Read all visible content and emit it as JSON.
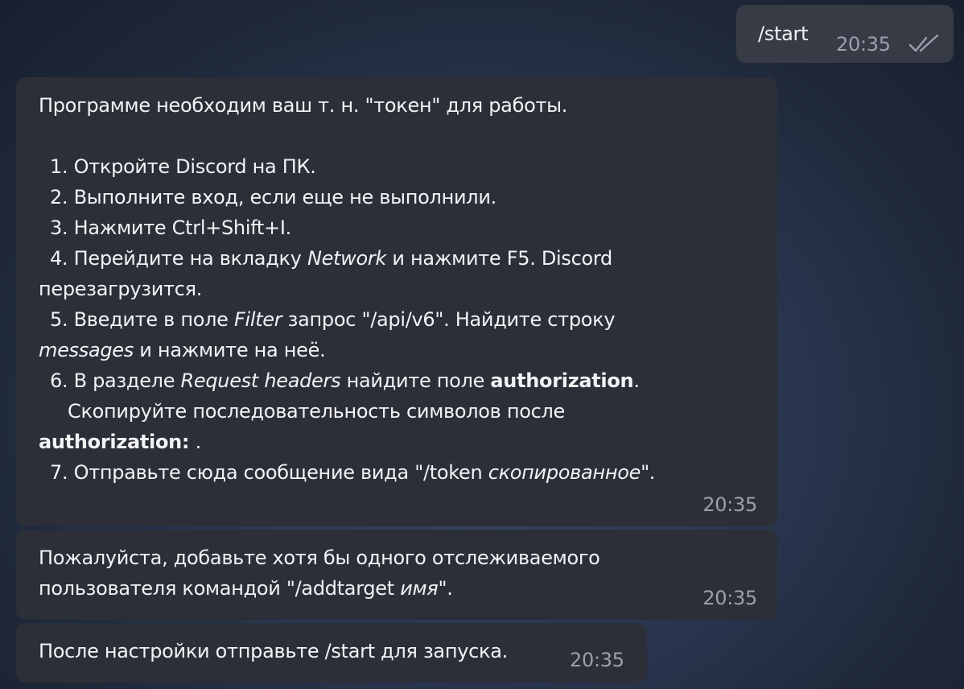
{
  "messages": {
    "outgoing": {
      "text": "/start",
      "time": "20:35",
      "status_icon": "double-check-icon"
    },
    "bot_1": {
      "intro": "Программе необходим ваш т. н. \"токен\" для работы.",
      "step1": "1. Откройте Discord на ПК.",
      "step2": "2. Выполните вход, если еще не выполнили.",
      "step3": "3. Нажмите Ctrl+Shift+I.",
      "step4_a": "4. Перейдите на вкладку ",
      "step4_em": "Network",
      "step4_b": " и нажмите F5. Discord",
      "step4_c": "перезагрузится.",
      "step5_a": "5. Введите в поле ",
      "step5_em": "Filter",
      "step5_b": " запрос \"/api/v6\". Найдите строку",
      "step5_em2": "messages",
      "step5_c": " и нажмите на неё.",
      "step6_a": "6. В разделе ",
      "step6_em": "Request headers",
      "step6_b": " найдите поле ",
      "step6_strong": "authorization",
      "step6_c": ".",
      "step6_d": "Скопируйте последовательность символов после",
      "step6_strong2": "authorization:",
      "step6_e": " .",
      "step7_a": "7. Отправьте сюда сообщение вида \"/token ",
      "step7_em": "скопированное",
      "step7_b": "\".",
      "time": "20:35"
    },
    "bot_2": {
      "line1": "Пожалуйста, добавьте хотя бы одного отслеживаемого",
      "line2_a": "пользователя командой \"/addtarget ",
      "line2_em": "имя",
      "line2_b": "\".",
      "time": "20:35"
    },
    "bot_3": {
      "text": "После настройки отправьте /start для запуска.",
      "time": "20:35"
    }
  }
}
